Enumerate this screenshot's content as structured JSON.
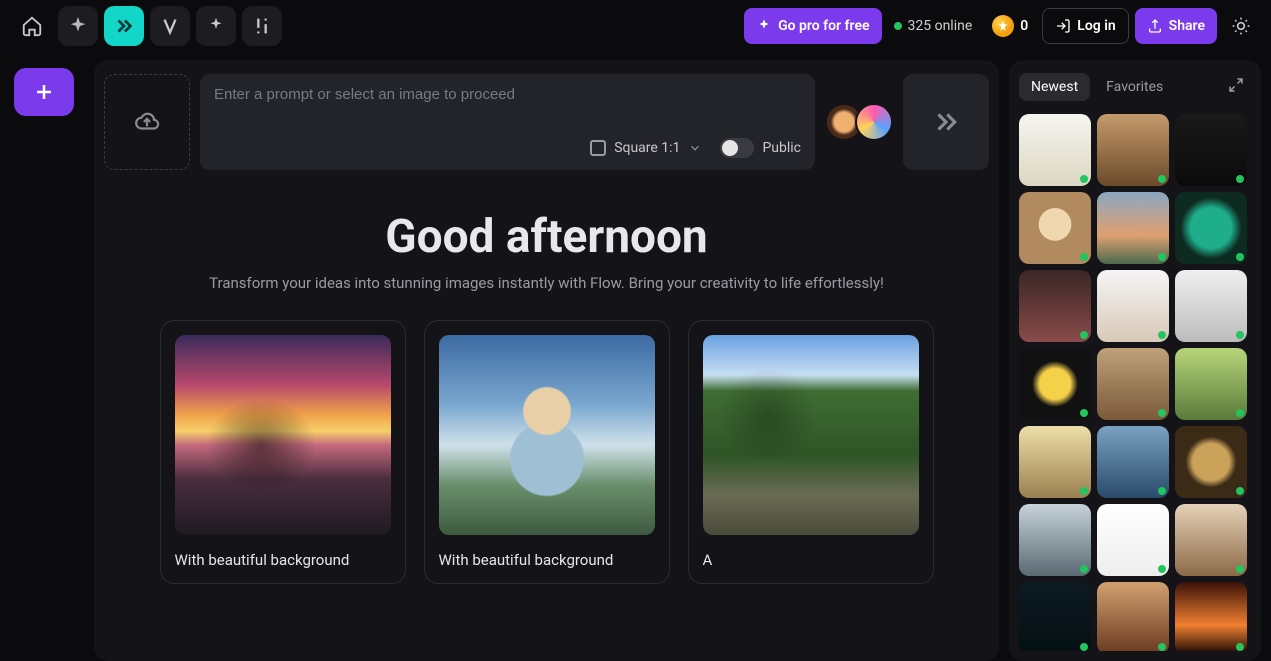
{
  "header": {
    "go_pro_label": "Go pro for free",
    "online_text": "325 online",
    "coins_value": "0",
    "login_label": "Log in",
    "share_label": "Share"
  },
  "prompt": {
    "placeholder": "Enter a prompt or select an image to proceed",
    "aspect_label": "Square 1:1",
    "public_label": "Public"
  },
  "greeting": {
    "title": "Good afternoon",
    "subtitle": "Transform your ideas into stunning images instantly with Flow. Bring your creativity to life effortlessly!"
  },
  "cards": [
    {
      "caption": "With beautiful background"
    },
    {
      "caption": "With beautiful background"
    },
    {
      "caption": "A"
    }
  ],
  "right_panel": {
    "tab_newest": "Newest",
    "tab_favorites": "Favorites"
  }
}
